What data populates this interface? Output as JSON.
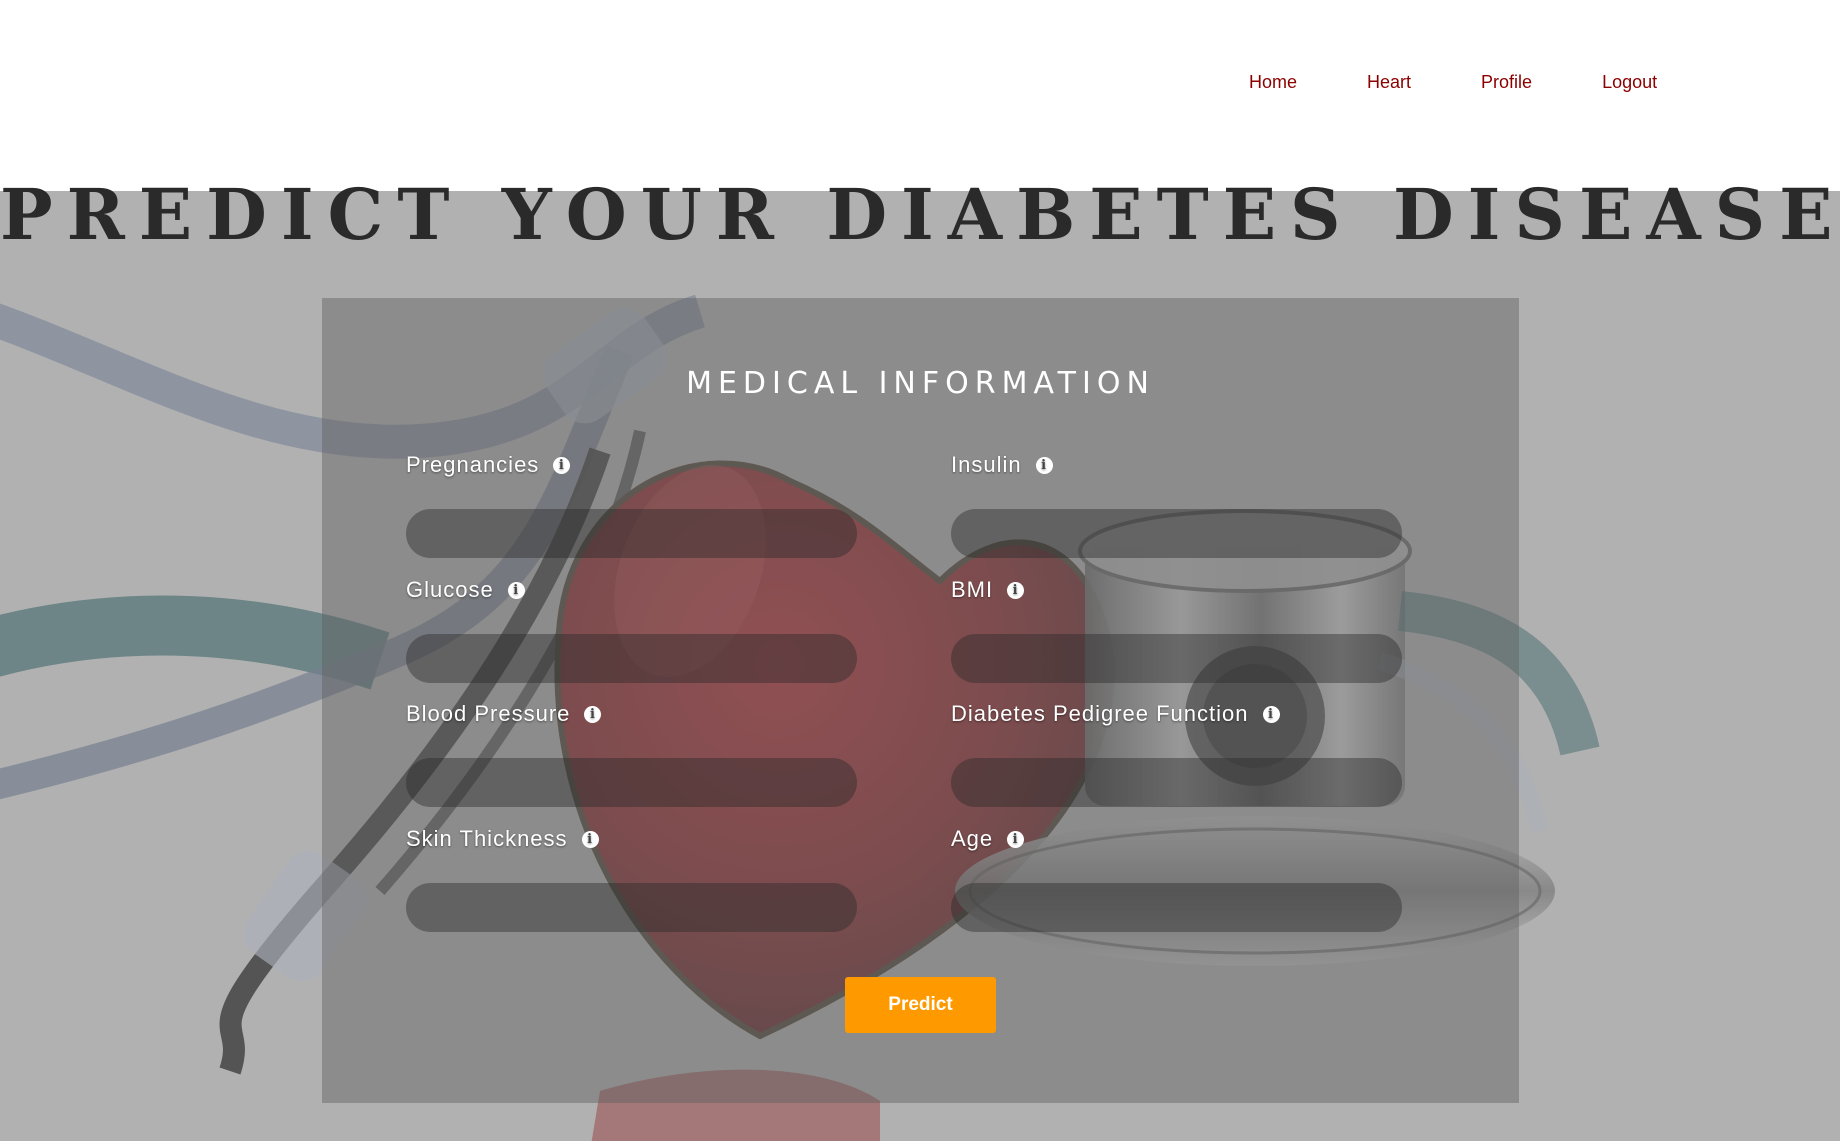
{
  "nav": {
    "items": [
      "Home",
      "Heart",
      "Profile",
      "Logout"
    ]
  },
  "page": {
    "title": "PREDICT YOUR DIABETES DISEASE"
  },
  "form": {
    "heading": "MEDICAL INFORMATION",
    "fields": {
      "pregnancies": {
        "label": "Pregnancies",
        "value": ""
      },
      "insulin": {
        "label": "Insulin",
        "value": ""
      },
      "glucose": {
        "label": "Glucose",
        "value": ""
      },
      "bmi": {
        "label": "BMI",
        "value": ""
      },
      "blood_pressure": {
        "label": "Blood Pressure",
        "value": ""
      },
      "dpf": {
        "label": "Diabetes Pedigree Function",
        "value": ""
      },
      "skin_thickness": {
        "label": "Skin Thickness",
        "value": ""
      },
      "age": {
        "label": "Age",
        "value": ""
      }
    },
    "submit_label": "Predict"
  },
  "icons": {
    "info": "info-circle-icon"
  },
  "colors": {
    "nav_link": "#8b0000",
    "button": "#ff9900",
    "title": "#2a2a2a",
    "text_on_panel": "#ffffff"
  }
}
